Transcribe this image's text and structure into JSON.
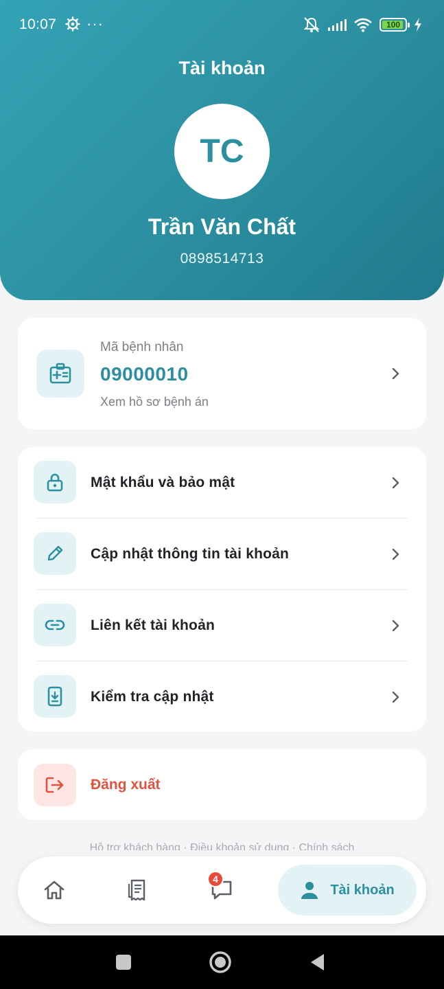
{
  "status_bar": {
    "time": "10:07",
    "dots": "···",
    "battery": "100"
  },
  "header": {
    "title": "Tài khoản",
    "avatar_initials": "TC",
    "name": "Trần Văn Chất",
    "phone": "0898514713"
  },
  "patient": {
    "label": "Mã bệnh nhân",
    "code": "09000010",
    "sub": "Xem hồ sơ bệnh án"
  },
  "menu": [
    {
      "label": "Mật khẩu và bảo mật",
      "icon": "lock-icon"
    },
    {
      "label": "Cập nhật thông tin tài khoản",
      "icon": "pencil-icon"
    },
    {
      "label": "Liên kết tài khoản",
      "icon": "link-icon"
    },
    {
      "label": "Kiểm tra cập nhật",
      "icon": "phone-download-icon"
    }
  ],
  "logout": {
    "label": "Đăng xuất",
    "icon": "logout-icon"
  },
  "footer_text": "Hỗ trợ khách hàng · Điều khoản sử dụng · Chính sách",
  "bottom_nav": {
    "messages_badge": "4",
    "active_label": "Tài khoản"
  },
  "colors": {
    "primary": "#2b8fa0",
    "danger": "#e0533e",
    "badge": "#e64a3b"
  }
}
